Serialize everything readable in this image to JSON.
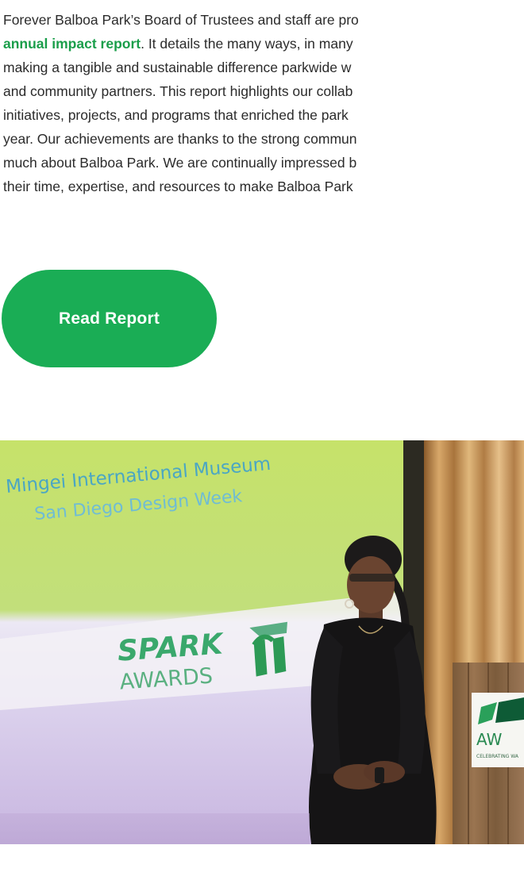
{
  "intro": {
    "line1": "Forever Balboa Park’s Board of Trustees and staff are pro",
    "link_text": "annual impact report",
    "line2_rest": ". It details the many ways, in many",
    "line3": "making a tangible and sustainable difference parkwide w",
    "line4": "and community partners. This report highlights our collab",
    "line5": "initiatives, projects, and programs that enriched the park",
    "line6": "year. Our achievements are thanks to the strong commun",
    "line7": "much about Balboa Park. We are continually impressed b",
    "line8": "their time, expertise, and resources to make Balboa Park"
  },
  "cta": {
    "read_report_label": "Read Report"
  },
  "photo": {
    "screen_title": "Mingei International Museum",
    "screen_subtitle": "San Diego Design Week",
    "logo_spark": "SPARK",
    "logo_awards": "AWARDS",
    "podium_awards": "AW",
    "podium_tagline": "CELEBRATING WA"
  },
  "colors": {
    "accent_green": "#1aad55",
    "link_green": "#1a9e4a"
  }
}
